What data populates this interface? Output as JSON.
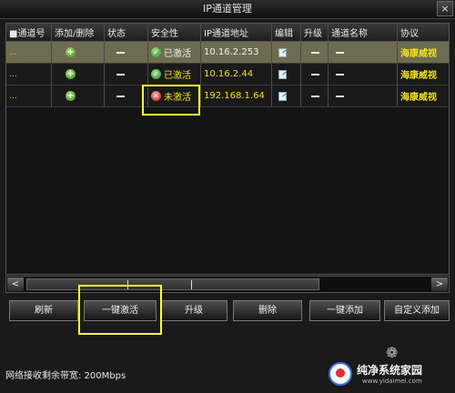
{
  "window": {
    "title": "IP通道管理",
    "close_label": "×"
  },
  "table": {
    "headers": [
      "■通道号",
      "添加/删除",
      "状态",
      "安全性",
      "IP通道地址",
      "编辑",
      "升级",
      "通道名称",
      "协议"
    ],
    "rows": [
      {
        "channel": "...",
        "security": "已激活",
        "ip": "10.16.2.253",
        "name": "—",
        "protocol": "海康威视"
      },
      {
        "channel": "...",
        "security": "已激活",
        "ip": "10.16.2.44",
        "name": "—",
        "protocol": "海康威视"
      },
      {
        "channel": "...",
        "security": "未激活",
        "ip": "192.168.1.64",
        "name": "—",
        "protocol": "海康威视"
      }
    ]
  },
  "scrollbar": {
    "left_arrow": "<",
    "right_arrow": ">"
  },
  "buttons": {
    "refresh": "刷新",
    "one_click_activate": "一键激活",
    "upgrade": "升级",
    "delete": "删除",
    "one_click_add": "一键添加",
    "custom_add": "自定义添加"
  },
  "status": {
    "bandwidth": "网络接收剩余带宽: 200Mbps"
  },
  "watermark": {
    "text": "纯净系统家园",
    "url": "www.yidaimei.com"
  },
  "colors": {
    "accent": "#f2e020",
    "highlight_box": "#ffff33",
    "selected_row": "#6e6c50"
  }
}
